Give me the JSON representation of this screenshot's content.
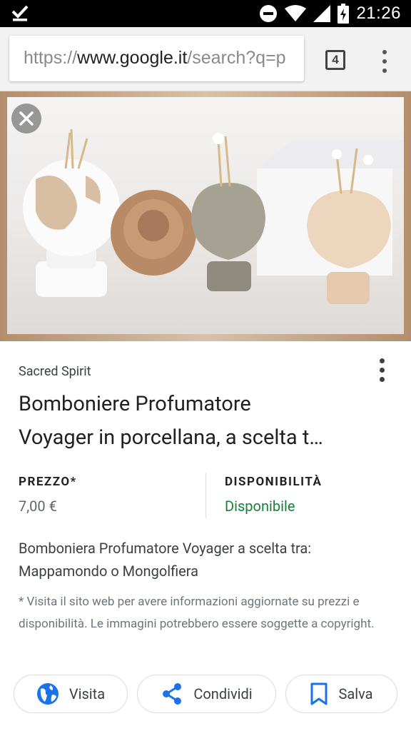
{
  "status_bar": {
    "time": "21:26"
  },
  "browser": {
    "url_scheme": "https://",
    "url_host": "www.google.it",
    "url_path": "/search?q=p",
    "tab_count": "4"
  },
  "result": {
    "source": "Sacred Spirit",
    "title_line1": "Bomboniere Profumatore",
    "title_line2": "Voyager in porcellana, a scelta t…",
    "price_label": "PREZZO*",
    "price_value": "7,00 €",
    "availability_label": "DISPONIBILITÀ",
    "availability_value": "Disponibile",
    "description": "Bomboniera Profumatore Voyager a scelta tra: Mappamondo o Mongolfiera",
    "disclaimer": "* Visita il sito web per avere informazioni aggiornate su prezzi e disponibilità. Le immagini potrebbero essere soggette a copyright."
  },
  "actions": {
    "visit_label": "Visita",
    "share_label": "Condividi",
    "save_label": "Salva"
  },
  "colors": {
    "availability_green": "#188038",
    "icon_blue": "#1a73e8",
    "image_frame": "#b48e6c"
  },
  "icons": {
    "status": [
      "check-icon",
      "do-not-disturb-icon",
      "wifi-icon",
      "signal-icon",
      "battery-charging-icon"
    ],
    "actions": [
      "globe-icon",
      "share-icon",
      "bookmark-icon"
    ]
  }
}
